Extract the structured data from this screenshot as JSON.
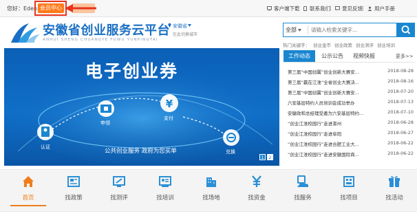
{
  "top_bar": {
    "greeting": "您好：Eden",
    "member_button": "会员中心",
    "links": [
      {
        "icon": "monitor-icon",
        "label": "客户端下载"
      },
      {
        "icon": "phone-icon",
        "label": "联系我们"
      },
      {
        "icon": "message-icon",
        "label": "意见反馈"
      },
      {
        "icon": "user-icon",
        "label": "用户手册"
      }
    ]
  },
  "header": {
    "title": "安徽省创业服务云平台",
    "subtitle": "ANHUI SHENG CHUANGYE FUWU YUNPINGTAI",
    "region": "安徽省",
    "region_hint": "在此切换城市"
  },
  "search": {
    "category": "全部",
    "placeholder": "请输入检索关键字...",
    "hot_label": "热门关键字：",
    "hot_keywords": [
      "创业金币",
      "创业政策",
      "创业测评",
      "创业培训"
    ]
  },
  "banner": {
    "title": "电子创业券",
    "slogan": "公共创业服务 政府为您买单",
    "nodes": [
      "认证",
      "申领",
      "支付",
      "兑换"
    ],
    "pager": [
      "1",
      "2"
    ]
  },
  "news": {
    "tabs": [
      "工作动态",
      "公示公告",
      "视频快报"
    ],
    "active_tab": "工作动态",
    "more": "更多>>",
    "items": [
      {
        "title": "第三届“中国创翼”创业创新大赛安...",
        "date": "2018-08-28"
      },
      {
        "title": "第三届“赢在江淮”全省创业大赛决...",
        "date": "2018-08-16"
      },
      {
        "title": "第三届“中国创翼”创业创新大赛安...",
        "date": "2018-07-20"
      },
      {
        "title": "六安基层特约人员培训会成功举办",
        "date": "2018-07-13"
      },
      {
        "title": "安徽政和总经理受邀为六安基层特约...",
        "date": "2018-07-10"
      },
      {
        "title": "“创业江淮校园行”走进滁州",
        "date": "2018-06-28"
      },
      {
        "title": "“创业江淮校园行”走进阜阳",
        "date": "2018-06-27"
      },
      {
        "title": "“创业江淮校园行”走进合肥工业大...",
        "date": "2018-06-22"
      },
      {
        "title": "“创业江淮校园行”走进安徽国际商...",
        "date": "2018-06-22"
      }
    ]
  },
  "nav": [
    {
      "label": "首页",
      "icon": "home-icon"
    },
    {
      "label": "找政策",
      "icon": "policy-icon"
    },
    {
      "label": "找测评",
      "icon": "assessment-icon"
    },
    {
      "label": "找培训",
      "icon": "training-icon"
    },
    {
      "label": "找场地",
      "icon": "building-icon"
    },
    {
      "label": "找资金",
      "icon": "yen-icon"
    },
    {
      "label": "找服务",
      "icon": "service-icon"
    },
    {
      "label": "找项目",
      "icon": "project-icon"
    },
    {
      "label": "找活动",
      "icon": "gift-icon"
    }
  ],
  "colors": {
    "brand": "#1a86d0",
    "accent": "#f07d1b",
    "highlight": "#e8341c"
  }
}
